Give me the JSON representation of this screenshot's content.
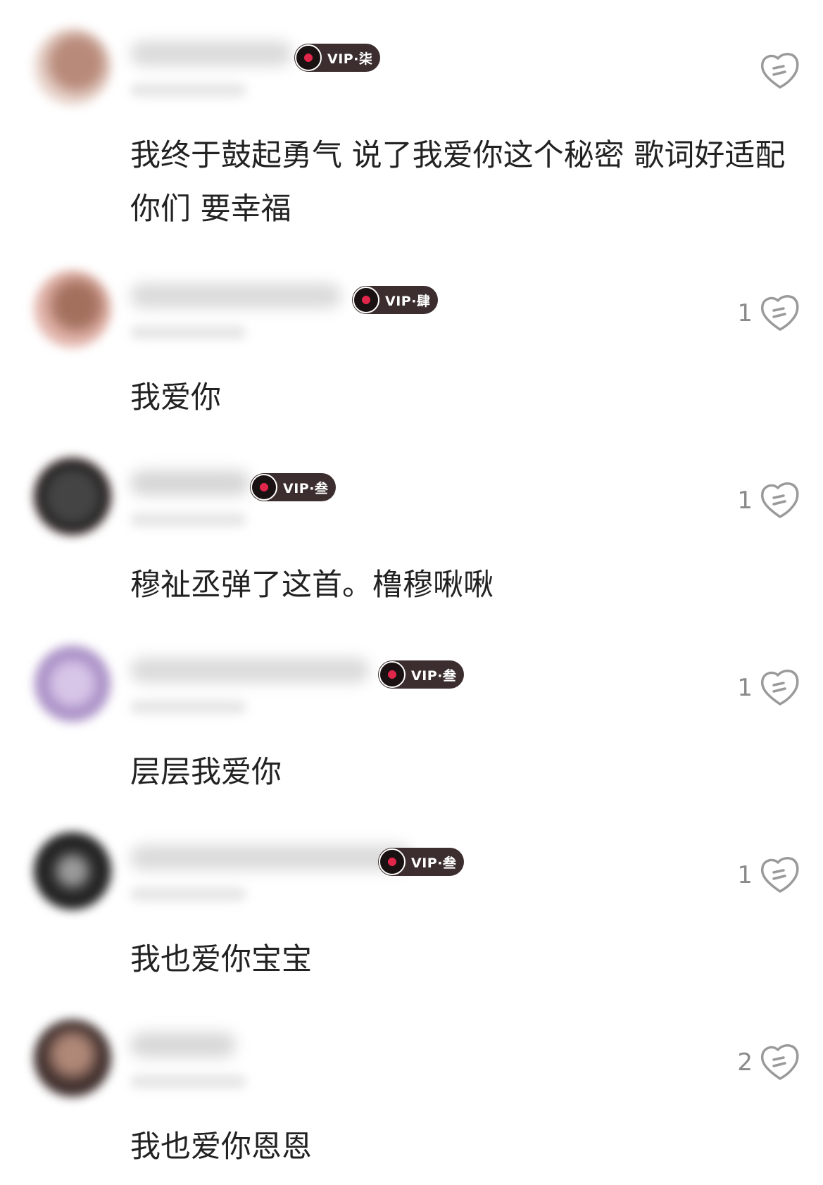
{
  "comments": [
    {
      "vip": "VIP·柒",
      "text": "我终于鼓起勇气 说了我爱你这个秘密 歌词好适配你们 要幸福",
      "likes": ""
    },
    {
      "vip": "VIP·肆",
      "text": "我爱你",
      "likes": "1"
    },
    {
      "vip": "VIP·叁",
      "text": "穆祉丞弹了这首。橹穆啾啾",
      "likes": "1"
    },
    {
      "vip": "VIP·叁",
      "text": "层层我爱你",
      "likes": "1"
    },
    {
      "vip": "VIP·叁",
      "text": "我也爱你宝宝",
      "likes": "1"
    },
    {
      "vip": "",
      "text": "我也爱你恩恩",
      "likes": "2"
    }
  ],
  "colors": {
    "vip_badge": "#3c2e2e",
    "vip_disc_center": "#e0264a",
    "comment_text": "#222222",
    "like_count": "#8a8a8a",
    "like_icon": "#9a9a9a"
  },
  "icons": {
    "like": "heart-like-icon",
    "vip_disc": "vinyl-disc-icon"
  }
}
